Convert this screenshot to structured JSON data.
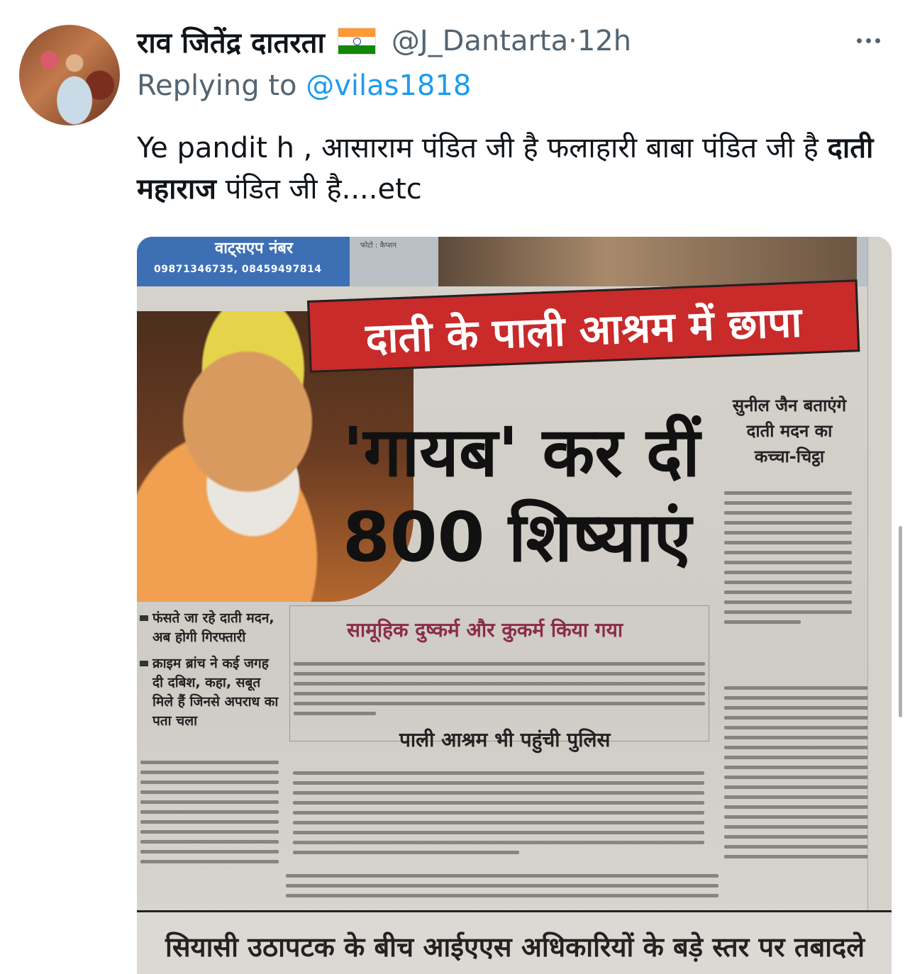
{
  "tweet": {
    "author_name": "राव जितेंद्र दातरता",
    "author_flag": "india-flag",
    "handle": "@J_Dantarta",
    "separator": "·",
    "time": "12h",
    "reply_prefix": "Replying to",
    "reply_to": "@vilas1818",
    "text_part1": "Ye pandit h , आसाराम पंडित जी है फलाहारी बाबा पंडित जी है ",
    "text_bold": "दाती महाराज",
    "text_part2": " पंडित जी है....etc"
  },
  "newspaper": {
    "top_label": "वाट्सएप नंबर",
    "phone_numbers": "09871346735, 08459497814",
    "photo_credit": "फोटो : कैप्शन",
    "banner": "दाती के पाली आश्रम में छापा",
    "headline_line1": "'गायब' कर दीं",
    "headline_line2": "800 शिष्याएं",
    "side_title": "सुनील जैन बताएंगे दाती मदन का कच्चा-चिट्ठा",
    "bullet1": "फंसते जा रहे दाती मदन, अब होगी गिरफ्तारी",
    "bullet2": "क्राइम ब्रांच ने कई जगह दी दबिश, कहा, सबूत मिले हैं जिनसे अपराध का पता चला",
    "box_title": "सामूहिक दुष्कर्म और कुकर्म किया गया",
    "sub_heading": "पाली आश्रम भी पहुंची पुलिस",
    "bottom_headline": "सियासी उठापटक के बीच आईएएस अधिकारियों के बड़े स्तर पर तबादले"
  },
  "colors": {
    "accent": "#1d9bf0",
    "secondary_text": "#536471",
    "banner_red": "#c92a2a"
  }
}
